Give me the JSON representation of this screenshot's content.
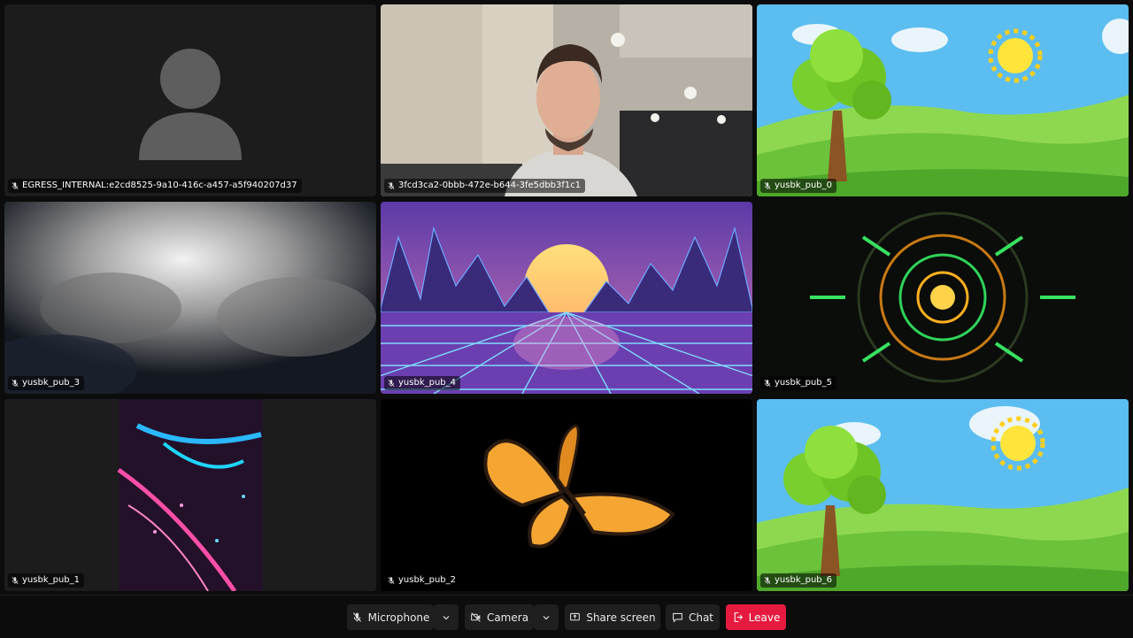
{
  "tiles": [
    {
      "id": "egress",
      "label": "EGRESS_INTERNAL:e2cd8525-9a10-416c-a457-a5f940207d37",
      "type": "avatar"
    },
    {
      "id": "camera",
      "label": "3fcd3ca2-0bbb-472e-b644-3fe5dbb3f1c1",
      "type": "person"
    },
    {
      "id": "pub0",
      "label": "yusbk_pub_0",
      "type": "cartoon"
    },
    {
      "id": "pub3",
      "label": "yusbk_pub_3",
      "type": "clouds"
    },
    {
      "id": "pub4",
      "label": "yusbk_pub_4",
      "type": "synthwave"
    },
    {
      "id": "pub5",
      "label": "yusbk_pub_5",
      "type": "tunnel"
    },
    {
      "id": "pub1",
      "label": "yusbk_pub_1",
      "type": "neon-portrait"
    },
    {
      "id": "pub2",
      "label": "yusbk_pub_2",
      "type": "butterfly"
    },
    {
      "id": "pub6",
      "label": "yusbk_pub_6",
      "type": "cartoon"
    }
  ],
  "controls": {
    "microphone": "Microphone",
    "camera": "Camera",
    "share_screen": "Share screen",
    "chat": "Chat",
    "leave": "Leave"
  },
  "icons": {
    "mic_muted": "mic-muted-icon",
    "camera": "camera-off-icon",
    "share": "share-screen-icon",
    "chat": "chat-icon",
    "leave": "leave-icon",
    "dropdown": "chevron-down-icon"
  },
  "colors": {
    "background": "#0c0c0c",
    "tile_background": "#1a1a1a",
    "button_background": "#1f1f1f",
    "leave": "#e51a3e"
  }
}
